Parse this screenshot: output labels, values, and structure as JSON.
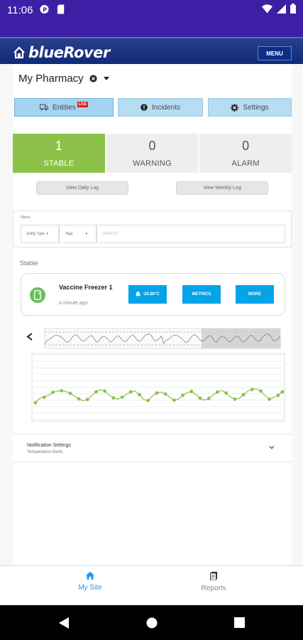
{
  "status_bar": {
    "time": "11:06"
  },
  "header": {
    "brand": "blueRover",
    "menu_label": "MENU"
  },
  "site": {
    "name": "My Pharmacy"
  },
  "tabs": [
    {
      "label": "Entities",
      "badge": "LIVE",
      "active": true
    },
    {
      "label": "Incidents",
      "active": false
    },
    {
      "label": "Settings",
      "active": false
    }
  ],
  "status_cards": [
    {
      "count": "1",
      "label": "STABLE"
    },
    {
      "count": "0",
      "label": "WARNING"
    },
    {
      "count": "0",
      "label": "ALARM"
    }
  ],
  "logs": {
    "daily": "View Daily Log",
    "weekly": "View Weekly Log"
  },
  "filters": {
    "title": "Filters",
    "entity_type": "Entity Type",
    "tags": "Tags",
    "search_placeholder": "SEARCH"
  },
  "section_label": "Stable",
  "entity": {
    "name": "Vaccine Freezer 1",
    "updated": "a minute ago",
    "temperature": "-20.80°C",
    "metrics_label": "METRICS",
    "more_label": "MORE"
  },
  "chart_data": {
    "type": "line",
    "values": [
      5.2,
      6.6,
      6.9,
      7.5,
      8.4,
      8.8,
      8.9,
      8.7,
      8.1,
      7.3,
      6.4,
      5.8,
      6.2,
      7.4,
      8.6,
      9.2,
      8.8,
      7.6,
      6.7,
      6.3,
      6.9,
      7.8,
      8.6,
      8.8,
      7.7,
      6.2,
      5.9,
      7.3,
      8.2,
      8.5,
      7.9,
      6.9,
      6.0,
      6.3,
      7.5,
      8.3,
      8.7,
      7.8,
      6.6,
      6.0,
      6.5,
      7.6,
      8.5,
      9.0,
      8.2,
      7.0,
      6.3,
      6.5,
      7.7,
      8.8,
      9.3,
      9.5,
      8.8,
      7.4,
      6.3,
      6.8,
      7.5,
      8.6
    ],
    "ylim": [
      0,
      20
    ]
  },
  "notification": {
    "title": "Notification Settings",
    "subtitle": "Temperature Alerts"
  },
  "bottom_nav": [
    {
      "label": "My Site",
      "active": true
    },
    {
      "label": "Reports",
      "active": false
    }
  ],
  "colors": {
    "accent": "#03a4e8",
    "stable": "#8cc24a",
    "statusbar": "#3d1fa6",
    "header": "#0e2a78",
    "tab": "#b6ddf2"
  }
}
